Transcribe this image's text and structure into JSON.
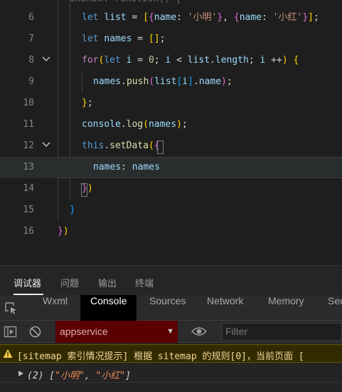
{
  "editor": {
    "lines": [
      {
        "num": "6"
      },
      {
        "num": "7"
      },
      {
        "num": "8"
      },
      {
        "num": "9"
      },
      {
        "num": "10"
      },
      {
        "num": "11"
      },
      {
        "num": "12"
      },
      {
        "num": "13"
      },
      {
        "num": "14"
      },
      {
        "num": "15"
      },
      {
        "num": "16"
      }
    ],
    "code": {
      "l6_let": "let",
      "l6_list": "list",
      "l6_name1": "name",
      "l6_str1": "'小明'",
      "l6_name2": "name",
      "l6_str2": "'小红'",
      "l7_let": "let",
      "l7_names": "names",
      "l8_for": "for",
      "l8_let": "let",
      "l8_i": "i",
      "l8_zero": "0",
      "l8_i2": "i",
      "l8_list": "list",
      "l8_length": "length",
      "l8_i3": "i",
      "l9_names": "names",
      "l9_push": "push",
      "l9_list": "list",
      "l9_i": "i",
      "l9_name": "name",
      "l11_console": "console",
      "l11_log": "log",
      "l11_names": "names",
      "l12_this": "this",
      "l12_setData": "setData",
      "l13_key": "names",
      "l13_val": "names"
    }
  },
  "panel": {
    "tabs": [
      "调试器",
      "问题",
      "输出",
      "终端"
    ]
  },
  "devtools": {
    "tabs": [
      "Wxml",
      "Console",
      "Sources",
      "Network",
      "Memory",
      "Sec"
    ]
  },
  "toolbar": {
    "context": "appservice",
    "filter_placeholder": "Filter"
  },
  "console": {
    "warning": "[sitemap 索引情况提示] 根据 sitemap 的规则[0]，当前页面 [",
    "log_prefix": "(2) [",
    "log_item1": "\"小明\"",
    "log_sep": ", ",
    "log_item2": "\"小红\"",
    "log_suffix": "]"
  },
  "colors": {
    "keyword": "#569cd6",
    "control": "#c586c0",
    "variable": "#9cdcfe",
    "function": "#dcdcaa",
    "string": "#ce9178",
    "warning_bg": "#332b00",
    "context_bg": "#5a0000"
  }
}
